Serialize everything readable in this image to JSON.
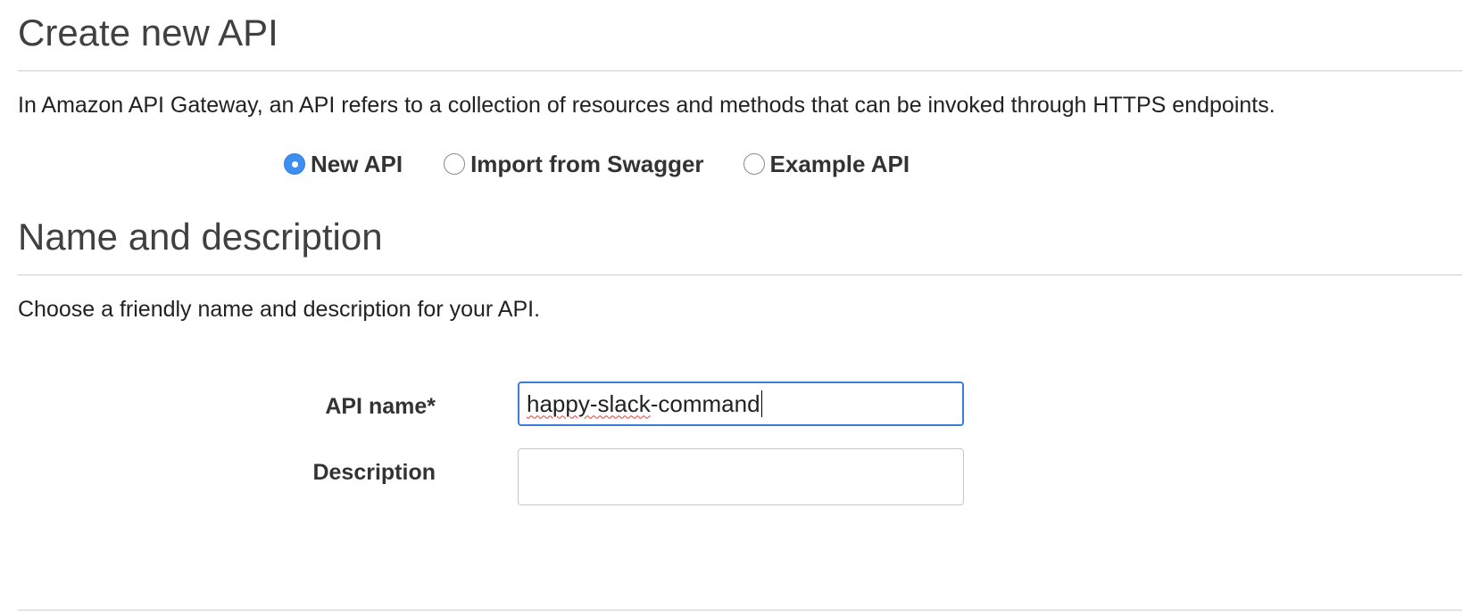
{
  "create_section": {
    "title": "Create new API",
    "description": "In Amazon API Gateway, an API refers to a collection of resources and methods that can be invoked through HTTPS endpoints."
  },
  "api_type": {
    "selected": "New API",
    "options": [
      {
        "label": "New API",
        "checked": true
      },
      {
        "label": "Import from Swagger",
        "checked": false
      },
      {
        "label": "Example API",
        "checked": false
      }
    ]
  },
  "name_section": {
    "title": "Name and description",
    "description": "Choose a friendly name and description for your API."
  },
  "form": {
    "api_name": {
      "label": "API name*",
      "value_misspelled": "happy-slack",
      "value_rest": "-command"
    },
    "description": {
      "label": "Description",
      "value": ""
    }
  },
  "colors": {
    "accent": "#3d8ef0",
    "focus_border": "#3b7dd8",
    "spellcheck": "#e53935"
  },
  "icons": {
    "radio_checked": "radio-checked-icon",
    "radio_unchecked": "radio-unchecked-icon"
  }
}
